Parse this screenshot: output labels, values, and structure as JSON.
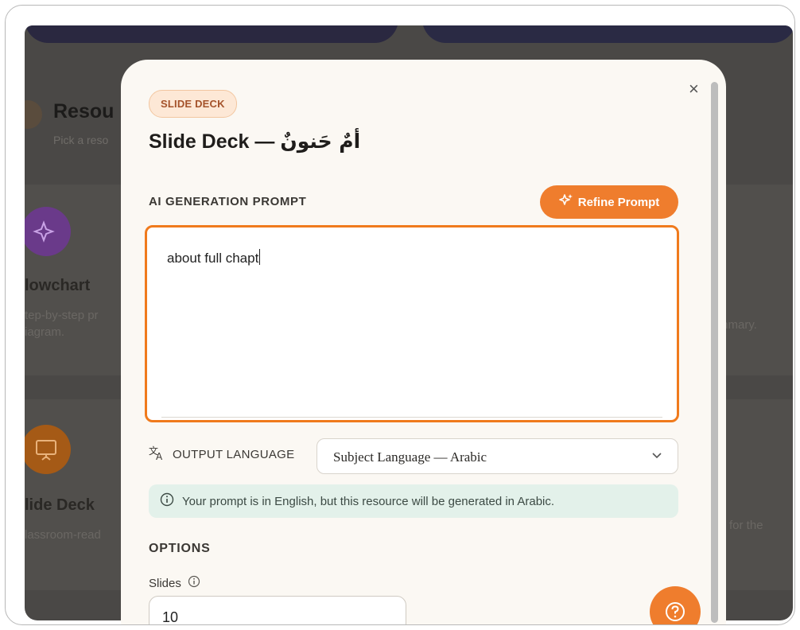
{
  "background": {
    "resources_title": "Resou",
    "resources_subtitle": "Pick a reso",
    "flowchart_title": "lowchart",
    "flowchart_desc_1": "tep-by-step pr",
    "flowchart_desc_2": "iagram.",
    "slide_deck_title": "lide Deck",
    "slide_deck_desc": "lassroom-read",
    "summary_desc": "mmary.",
    "questions_desc": "ns for the"
  },
  "modal": {
    "badge": "SLIDE DECK",
    "title_prefix": "Slide Deck —",
    "title_arabic": "أمٌ حَنونٌ",
    "close_label": "×",
    "prompt_section_label": "AI GENERATION PROMPT",
    "refine_button_label": "Refine Prompt",
    "prompt_value": "about full chapt",
    "output_language_label": "OUTPUT LANGUAGE",
    "output_language_value": "Subject Language — Arabic",
    "info_message": "Your prompt is in English, but this resource will be generated in Arabic.",
    "options_label": "OPTIONS",
    "slides_label": "Slides",
    "slides_value": "10"
  },
  "colors": {
    "accent": "#ef7d2d",
    "prompt_border": "#f07a1c",
    "info_bg": "#e3f1ea"
  },
  "icons": [
    "sparkle-icon",
    "translate-icon",
    "chevron-down-icon",
    "info-icon",
    "help-icon",
    "close-icon",
    "presentation-icon"
  ]
}
